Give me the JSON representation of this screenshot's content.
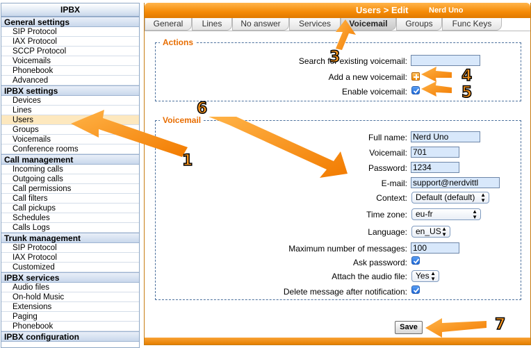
{
  "sidebar": {
    "title": "IPBX",
    "sections": [
      {
        "title": "General settings",
        "items": [
          "SIP Protocol",
          "IAX Protocol",
          "SCCP Protocol",
          "Voicemails",
          "Phonebook",
          "Advanced"
        ]
      },
      {
        "title": "IPBX settings",
        "items": [
          "Devices",
          "Lines",
          "Users",
          "Groups",
          "Voicemails",
          "Conference rooms"
        ]
      },
      {
        "title": "Call management",
        "items": [
          "Incoming calls",
          "Outgoing calls",
          "Call permissions",
          "Call filters",
          "Call pickups",
          "Schedules",
          "Calls Logs"
        ]
      },
      {
        "title": "Trunk management",
        "items": [
          "SIP Protocol",
          "IAX Protocol",
          "Customized"
        ]
      },
      {
        "title": "IPBX services",
        "items": [
          "Audio files",
          "On-hold Music",
          "Extensions",
          "Paging",
          "Phonebook"
        ]
      },
      {
        "title": "IPBX configuration",
        "items": []
      }
    ],
    "active_item": "Users"
  },
  "header": {
    "title": "Users > Edit",
    "user": "Nerd Uno"
  },
  "tabs": [
    {
      "label": "General",
      "active": false
    },
    {
      "label": "Lines",
      "active": false
    },
    {
      "label": "No answer",
      "active": false
    },
    {
      "label": "Services",
      "active": false
    },
    {
      "label": "Voicemail",
      "active": true
    },
    {
      "label": "Groups",
      "active": false
    },
    {
      "label": "Func Keys",
      "active": false
    }
  ],
  "actions": {
    "legend": "Actions",
    "search_label": "Search for existing voicemail:",
    "search_value": "",
    "add_label": "Add a new voicemail:",
    "add_icon": "plus-icon",
    "enable_label": "Enable voicemail:",
    "enable_checked": true
  },
  "voicemail": {
    "legend": "Voicemail",
    "fullname_label": "Full name:",
    "fullname_value": "Nerd Uno",
    "voicemail_label": "Voicemail:",
    "voicemail_value": "701",
    "password_label": "Password:",
    "password_value": "1234",
    "email_label": "E-mail:",
    "email_value": "support@nerdvittl",
    "context_label": "Context:",
    "context_value": "Default (default)",
    "timezone_label": "Time zone:",
    "timezone_value": "eu-fr",
    "language_label": "Language:",
    "language_value": "en_US",
    "maxmsg_label": "Maximum number of messages:",
    "maxmsg_value": "100",
    "askpass_label": "Ask password:",
    "askpass_checked": true,
    "attach_label": "Attach the audio file:",
    "attach_value": "Yes",
    "delete_label": "Delete message after notification:",
    "delete_checked": true
  },
  "save_label": "Save",
  "annotations": [
    "1",
    "3",
    "4",
    "5",
    "6",
    "7"
  ],
  "colors": {
    "accent": "#f7941d",
    "sidebar_border": "#8ea7c5",
    "input_bg": "#d8e8fb"
  }
}
